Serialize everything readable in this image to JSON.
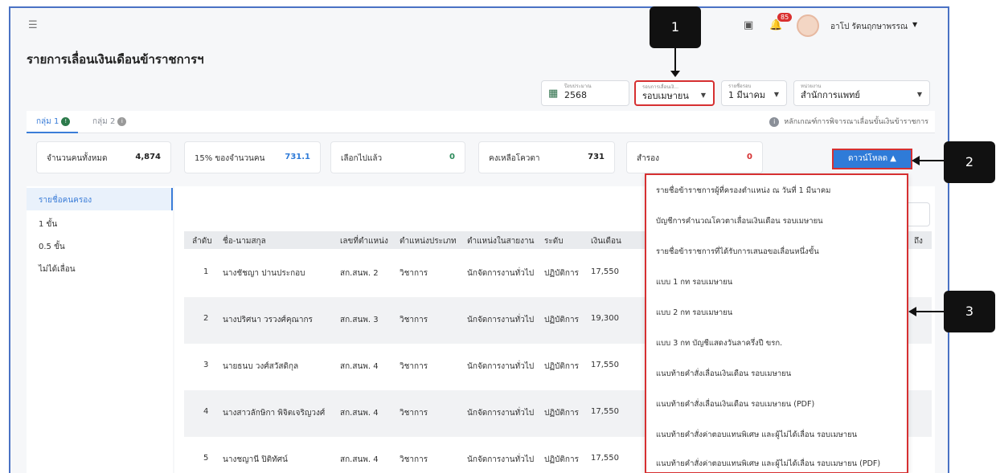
{
  "header": {
    "title": "รายการเลื่อนเงินเดือนข้าราชการฯ",
    "notification_count": "85",
    "username": "อาโป รัตนฤกษาพรรณ"
  },
  "filters": [
    {
      "label": "ปีงบประมาณ",
      "value": "2568"
    },
    {
      "label": "รอบการเลื่อนเงิ...",
      "value": "รอบเมษายน"
    },
    {
      "label": "รายชื่อรอบ",
      "value": "1 มีนาคม"
    },
    {
      "label": "หน่วยงาน",
      "value": "สำนักการแพทย์"
    }
  ],
  "tabs": [
    {
      "label": "กลุ่ม 1",
      "dot": "!"
    },
    {
      "label": "กลุ่ม 2",
      "dot": "i"
    }
  ],
  "criteria_link": "หลักเกณฑ์การพิจารณาเลื่อนขั้นเงินข้าราชการ",
  "stats": [
    {
      "label": "จำนวนคนทั้งหมด",
      "value": "4,874",
      "color": "#222222"
    },
    {
      "label": "15% ของจำนวนคน",
      "value": "731.1",
      "color": "#2f7bd8"
    },
    {
      "label": "เลือกไปแล้ว",
      "value": "0",
      "color": "#2c8a5a"
    },
    {
      "label": "คงเหลือโควตา",
      "value": "731",
      "color": "#222222"
    },
    {
      "label": "สำรอง",
      "value": "0",
      "color": "#d63031"
    }
  ],
  "download_label": "ดาวน์โหลด ▲",
  "sidebar": [
    {
      "label": "รายชื่อคนครอง"
    },
    {
      "label": "1 ขั้น"
    },
    {
      "label": "0.5 ขั้น"
    },
    {
      "label": "ไม่ได้เลื่อน"
    }
  ],
  "table": {
    "headers": [
      "ลำดับ",
      "ชื่อ-นามสกุล",
      "เลขที่ตำแหน่ง",
      "ตำแหน่งประเภท",
      "ตำแหน่งในสายงาน",
      "ระดับ",
      "เงินเดือน",
      "ถึง"
    ],
    "rows": [
      [
        "1",
        "นางชัชญา ปานประกอบ",
        "สก.สนพ. 2",
        "วิชาการ",
        "นักจัดการงานทั่วไป",
        "ปฏิบัติการ",
        "17,550"
      ],
      [
        "2",
        "นางปริศนา วรวงศ์คุณากร",
        "สก.สนพ. 3",
        "วิชาการ",
        "นักจัดการงานทั่วไป",
        "ปฏิบัติการ",
        "19,300"
      ],
      [
        "3",
        "นายธนบ วงศ์สวัสดิกุล",
        "สก.สนพ. 4",
        "วิชาการ",
        "นักจัดการงานทั่วไป",
        "ปฏิบัติการ",
        "17,550"
      ],
      [
        "4",
        "นางสาวลักษิกา พิจิตเจริญวงศ์",
        "สก.สนพ. 4",
        "วิชาการ",
        "นักจัดการงานทั่วไป",
        "ปฏิบัติการ",
        "17,550"
      ],
      [
        "5",
        "นางชญานี ปิติทัศน์",
        "สก.สนพ. 4",
        "วิชาการ",
        "นักจัดการงานทั่วไป",
        "ปฏิบัติการ",
        "17,550"
      ]
    ]
  },
  "download_menu": [
    "รายชื่อข้าราชการผู้ที่ครองตำแหน่ง ณ วันที่ 1 มีนาคม",
    "บัญชีการคำนวณโควตาเลื่อนเงินเดือน รอบเมษายน",
    "รายชื่อข้าราชการที่ได้รับการเสนอขอเลื่อนหนึ่งขั้น",
    "แบบ 1 กท รอบเมษายน",
    "แบบ 2 กท รอบเมษายน",
    "แบบ 3 กท บัญชีแสดงวันลาครึ่งปี ขรก.",
    "แนบท้ายคำสั่งเลื่อนเงินเดือน รอบเมษายน",
    "แนบท้ายคำสั่งเลื่อนเงินเดือน รอบเมษายน (PDF)",
    "แนบท้ายคำสั่งค่าตอบแทนพิเศษ และผู้ไม่ได้เลื่อน รอบเมษายน",
    "แนบท้ายคำสั่งค่าตอบแทนพิเศษ และผู้ไม่ได้เลื่อน รอบเมษายน (PDF)"
  ],
  "callouts": [
    "1",
    "2",
    "3"
  ]
}
